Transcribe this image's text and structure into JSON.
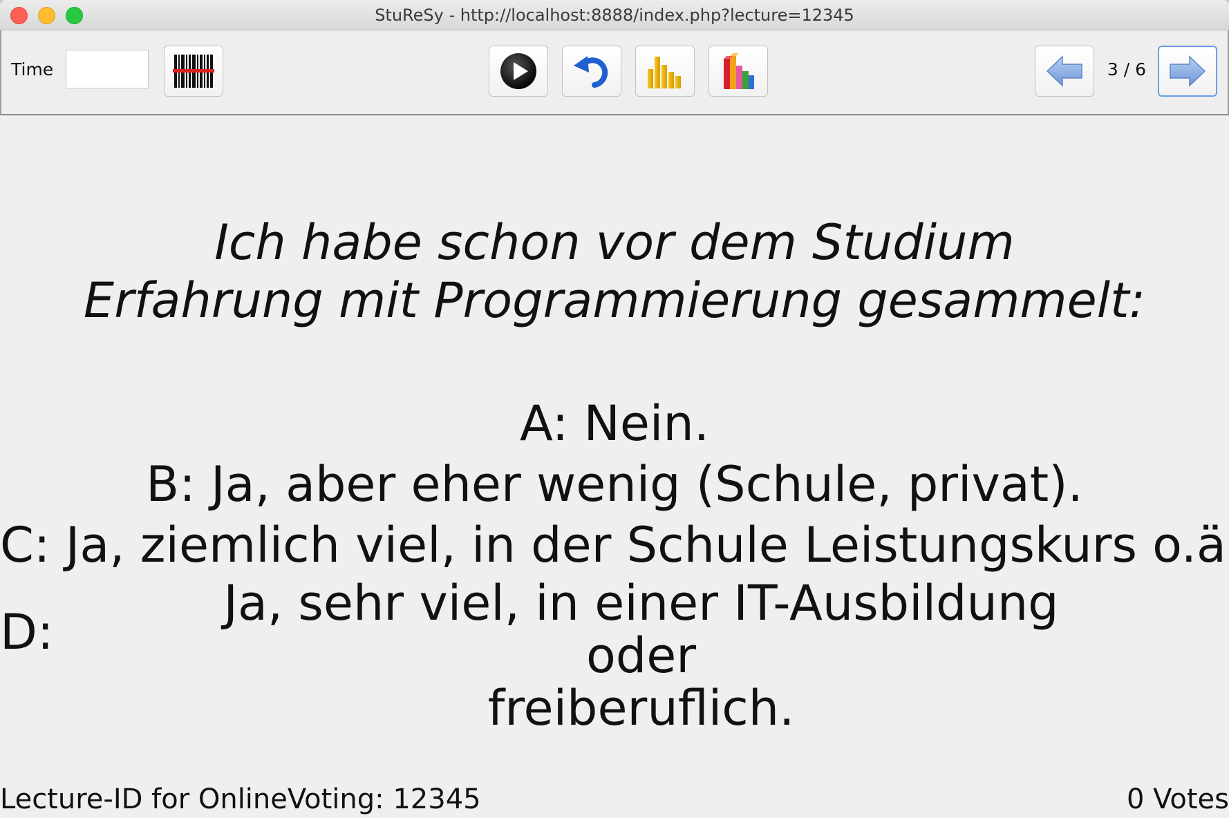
{
  "window": {
    "title": "StuReSy - http://localhost:8888/index.php?lecture=12345"
  },
  "toolbar": {
    "time_label": "Time",
    "time_value": "",
    "barcode_icon": "barcode-icon",
    "start_icon": "play-icon",
    "reset_icon": "undo-icon",
    "histogram_icon": "bar-chart-icon",
    "chart3d_icon": "3d-chart-icon",
    "prev_icon": "left-arrow-icon",
    "next_icon": "right-arrow-icon",
    "page_indicator": "3 / 6"
  },
  "question": {
    "line1": "Ich habe schon vor dem Studium",
    "line2": "Erfahrung mit Programmierung gesammelt:"
  },
  "answers": {
    "a": "A: Nein.",
    "b": "B: Ja, aber eher wenig (Schule, privat).",
    "c": "C: Ja, ziemlich viel, in der Schule Leistungskurs o.ä.",
    "d_label": "D:",
    "d_line1": "Ja, sehr viel, in einer IT-Ausbildung oder",
    "d_line2": "freiberuflich."
  },
  "footer": {
    "lecture_id": "Lecture-ID for OnlineVoting: 12345",
    "votes": "0 Votes"
  },
  "colors": {
    "window_bg": "#efefef",
    "next_button_border": "#6a9ee8",
    "barcode_line": "#e0201c",
    "arrow_fill": "#8fb3e6"
  }
}
